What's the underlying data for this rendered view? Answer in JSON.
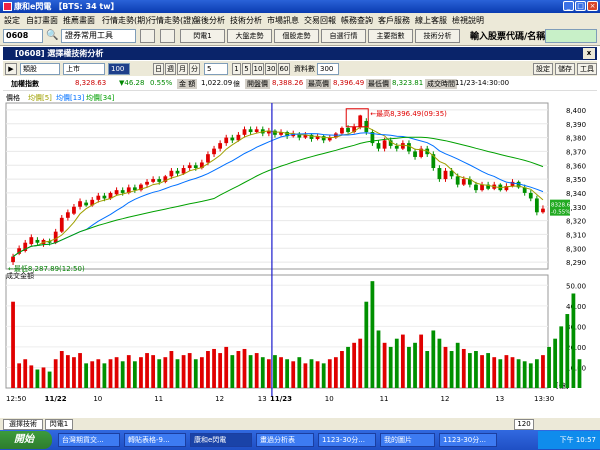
{
  "window": {
    "title": "康和e閃電 【BTS: 34 tw】"
  },
  "menu": [
    "設定",
    "自訂畫面",
    "推薦畫面",
    "行情走勢(期)",
    "行情走勢(證)",
    "盤後分析",
    "技術分析",
    "市場訊息",
    "交易回報",
    "帳務查詢",
    "客戶服務",
    "線上客服",
    "檢視說明"
  ],
  "toolbar": {
    "code": "0608",
    "tool_select": "證券常用工具",
    "buttons": [
      "閃電1",
      "大盤走勢",
      "個股走勢",
      "自選行情",
      "主要指數",
      "技術分析"
    ],
    "prompt": "輸入股票代碼/名稱:",
    "input_value": ""
  },
  "panel": {
    "title": "[0608] 選擇權技術分析",
    "close": "x"
  },
  "controls": {
    "type": "類股",
    "market": "上市",
    "num": "100",
    "periods": [
      "日",
      "週",
      "月",
      "分"
    ],
    "minute_value": "5",
    "minute_options": [
      "1",
      "5",
      "10",
      "30",
      "60"
    ],
    "bars_label": "資料數",
    "bars_value": "300",
    "right_buttons": [
      "設定",
      "儲存",
      "工具"
    ]
  },
  "info": {
    "name": "加權指數",
    "price": "8,328.63",
    "change": "▼46.28",
    "pct": "0.55%",
    "amount_label": "金 額",
    "amount": "1,022.09",
    "amount_unit": "億",
    "open_label": "開盤價",
    "open": "8,388.26",
    "high_label": "最高價",
    "high": "8,396.49",
    "low_label": "最低價",
    "low": "8,323.81",
    "time_label": "成交時間",
    "time": "11/23-14:30:00"
  },
  "chart_data": {
    "type": "candlestick",
    "title": "價格",
    "legend": [
      "均價[5]",
      "均價[13]",
      "均價[34]"
    ],
    "price_ylim": [
      8285,
      8405
    ],
    "price_ticks": [
      8290,
      8300,
      8310,
      8320,
      8330,
      8340,
      8350,
      8360,
      8370,
      8380,
      8390,
      8400
    ],
    "price_tick_labels": [
      "8,290",
      "8,300",
      "8,310",
      "8,320",
      "8,330",
      "8,340",
      "8,350",
      "8,360",
      "8,370",
      "8,380",
      "8,390",
      "8,400"
    ],
    "annotations": {
      "high": "最高8,396.49(09:35)",
      "low": "最低8,287.89(12:50)",
      "last_price": "8328.63",
      "last_pct": "-0.55%"
    },
    "volume_title": "成交金額",
    "volume_unit": "[億]",
    "volume_ylim": [
      0,
      55
    ],
    "volume_ticks": [
      10,
      20,
      30,
      40,
      50
    ],
    "volume_tick_labels": [
      "10.00",
      "20.00",
      "30.00",
      "40.00",
      "50.00"
    ],
    "x_labels": [
      "12:50",
      "11/22",
      "10",
      "11",
      "12",
      "13",
      "11/23",
      "10",
      "11",
      "12",
      "13",
      "13:30"
    ],
    "divider_label": "11/23",
    "candles": [
      [
        8290,
        8294,
        8296,
        8287.89
      ],
      [
        8296,
        8300,
        8302,
        8295
      ],
      [
        8298,
        8304,
        8306,
        8297
      ],
      [
        8303,
        8308,
        8310,
        8302
      ],
      [
        8306,
        8304,
        8308,
        8302
      ],
      [
        8303,
        8306,
        8307,
        8301
      ],
      [
        8305,
        8304,
        8307,
        8302
      ],
      [
        8304,
        8312,
        8314,
        8303
      ],
      [
        8312,
        8322,
        8324,
        8311
      ],
      [
        8322,
        8326,
        8328,
        8320
      ],
      [
        8325,
        8330,
        8332,
        8324
      ],
      [
        8330,
        8334,
        8336,
        8328
      ],
      [
        8333,
        8331,
        8335,
        8330
      ],
      [
        8331,
        8335,
        8337,
        8330
      ],
      [
        8335,
        8338,
        8340,
        8333
      ],
      [
        8338,
        8336,
        8340,
        8334
      ],
      [
        8336,
        8340,
        8341,
        8335
      ],
      [
        8339,
        8342,
        8344,
        8338
      ],
      [
        8342,
        8340,
        8344,
        8338
      ],
      [
        8340,
        8344,
        8346,
        8339
      ],
      [
        8344,
        8342,
        8346,
        8340
      ],
      [
        8342,
        8346,
        8347,
        8341
      ],
      [
        8346,
        8348,
        8350,
        8344
      ],
      [
        8348,
        8350,
        8352,
        8347
      ],
      [
        8350,
        8348,
        8352,
        8346
      ],
      [
        8348,
        8352,
        8353,
        8347
      ],
      [
        8352,
        8356,
        8358,
        8350
      ],
      [
        8356,
        8354,
        8358,
        8352
      ],
      [
        8354,
        8358,
        8360,
        8353
      ],
      [
        8358,
        8360,
        8362,
        8356
      ],
      [
        8360,
        8358,
        8362,
        8356
      ],
      [
        8358,
        8362,
        8364,
        8357
      ],
      [
        8362,
        8368,
        8370,
        8360
      ],
      [
        8368,
        8372,
        8374,
        8366
      ],
      [
        8372,
        8376,
        8378,
        8370
      ],
      [
        8376,
        8380,
        8382,
        8374
      ],
      [
        8380,
        8378,
        8382,
        8376
      ],
      [
        8378,
        8382,
        8384,
        8377
      ],
      [
        8382,
        8386,
        8388,
        8380
      ],
      [
        8386,
        8384,
        8388,
        8382
      ],
      [
        8384,
        8386,
        8388,
        8383
      ],
      [
        8386,
        8383,
        8388,
        8381
      ],
      [
        8383,
        8385,
        8387,
        8381
      ],
      [
        8385,
        8382,
        8386,
        8380
      ],
      [
        8382,
        8384,
        8386,
        8381
      ],
      [
        8384,
        8381,
        8385,
        8379
      ],
      [
        8381,
        8383,
        8385,
        8380
      ],
      [
        8383,
        8380,
        8384,
        8378
      ],
      [
        8380,
        8382,
        8384,
        8379
      ],
      [
        8382,
        8379,
        8383,
        8377
      ],
      [
        8379,
        8381,
        8383,
        8378
      ],
      [
        8381,
        8378,
        8382,
        8376
      ],
      [
        8378,
        8380,
        8382,
        8377
      ],
      [
        8380,
        8383,
        8384,
        8379
      ],
      [
        8383,
        8387,
        8388,
        8382
      ],
      [
        8387,
        8384,
        8389,
        8383
      ],
      [
        8384,
        8388,
        8390,
        8383
      ],
      [
        8388,
        8396,
        8396.49,
        8386
      ],
      [
        8392,
        8384,
        8394,
        8382
      ],
      [
        8384,
        8376,
        8386,
        8374
      ],
      [
        8376,
        8372,
        8378,
        8370
      ],
      [
        8372,
        8378,
        8380,
        8370
      ],
      [
        8378,
        8374,
        8380,
        8372
      ],
      [
        8374,
        8372,
        8376,
        8370
      ],
      [
        8372,
        8376,
        8378,
        8371
      ],
      [
        8376,
        8370,
        8378,
        8368
      ],
      [
        8370,
        8366,
        8372,
        8364
      ],
      [
        8366,
        8372,
        8374,
        8365
      ],
      [
        8372,
        8368,
        8374,
        8366
      ],
      [
        8368,
        8358,
        8370,
        8356
      ],
      [
        8358,
        8350,
        8360,
        8348
      ],
      [
        8350,
        8356,
        8358,
        8348
      ],
      [
        8356,
        8352,
        8358,
        8350
      ],
      [
        8352,
        8346,
        8354,
        8344
      ],
      [
        8346,
        8350,
        8352,
        8345
      ],
      [
        8350,
        8346,
        8352,
        8344
      ],
      [
        8346,
        8342,
        8348,
        8340
      ],
      [
        8342,
        8346,
        8348,
        8341
      ],
      [
        8346,
        8343,
        8348,
        8342
      ],
      [
        8343,
        8346,
        8348,
        8342
      ],
      [
        8346,
        8342,
        8347,
        8341
      ],
      [
        8342,
        8345,
        8347,
        8341
      ],
      [
        8345,
        8348,
        8350,
        8344
      ],
      [
        8348,
        8344,
        8349,
        8343
      ],
      [
        8344,
        8340,
        8346,
        8338
      ],
      [
        8340,
        8336,
        8342,
        8334
      ],
      [
        8336,
        8326,
        8338,
        8323.81
      ],
      [
        8326,
        8328.63,
        8331,
        8325
      ]
    ],
    "volume": [
      42,
      12,
      14,
      11,
      9,
      10,
      8,
      14,
      18,
      16,
      15,
      17,
      12,
      13,
      14,
      12,
      14,
      15,
      13,
      16,
      13,
      15,
      17,
      16,
      14,
      15,
      18,
      14,
      16,
      17,
      14,
      15,
      18,
      19,
      17,
      20,
      16,
      18,
      19,
      16,
      17,
      15,
      14,
      16,
      15,
      14,
      13,
      15,
      12,
      14,
      13,
      12,
      14,
      15,
      18,
      20,
      22,
      24,
      42,
      52,
      28,
      22,
      20,
      24,
      26,
      20,
      22,
      26,
      18,
      28,
      24,
      20,
      18,
      22,
      19,
      17,
      18,
      16,
      17,
      15,
      14,
      16,
      15,
      14,
      13,
      12,
      14,
      16,
      20,
      24,
      30,
      36,
      46,
      14
    ]
  },
  "statusbar": {
    "tabs": [
      "選擇技術",
      "閃電1"
    ],
    "zoom": "120"
  },
  "taskbar": {
    "start": "開始",
    "tasks": [
      "台灣期貨交...",
      "轉貼表格-9...",
      "康和e閃電",
      "畫過分析表",
      "1123-30分...",
      "我的圖片",
      "1123-30分..."
    ],
    "clock": "下午 10:57"
  },
  "colors": {
    "up": "#e00000",
    "down": "#009000",
    "ma5": "#9fa000",
    "ma13": "#0070ff",
    "ma34": "#00a000",
    "divider": "#1a1acc"
  }
}
